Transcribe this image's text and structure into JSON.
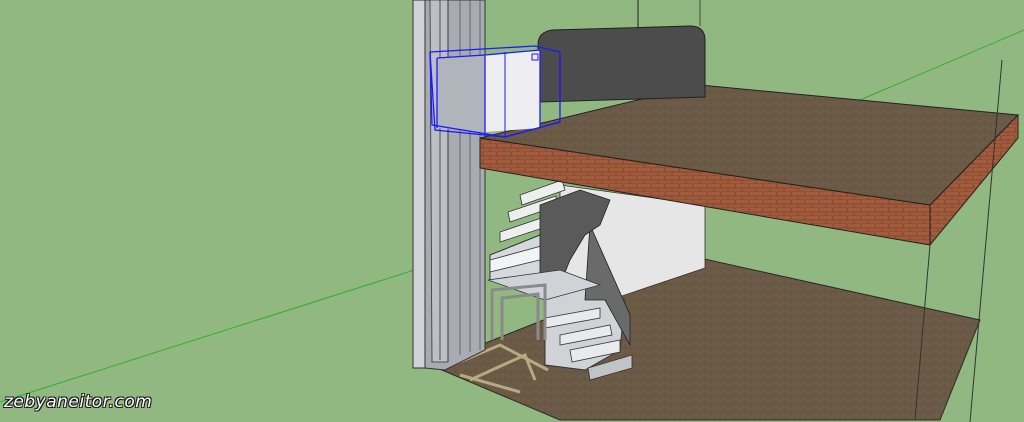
{
  "scene": {
    "background_color": "#90b880",
    "selection_color": "#1a1aff",
    "axis_color": "#2faf2f",
    "floor_color": "#6b5a45",
    "slab_top_color": "#6e5a45",
    "brick_color": "#a05a3c",
    "wall_color": "#4a4a4a",
    "selected_object": "cube"
  },
  "watermark": {
    "text": "zebyaneitor.com"
  }
}
